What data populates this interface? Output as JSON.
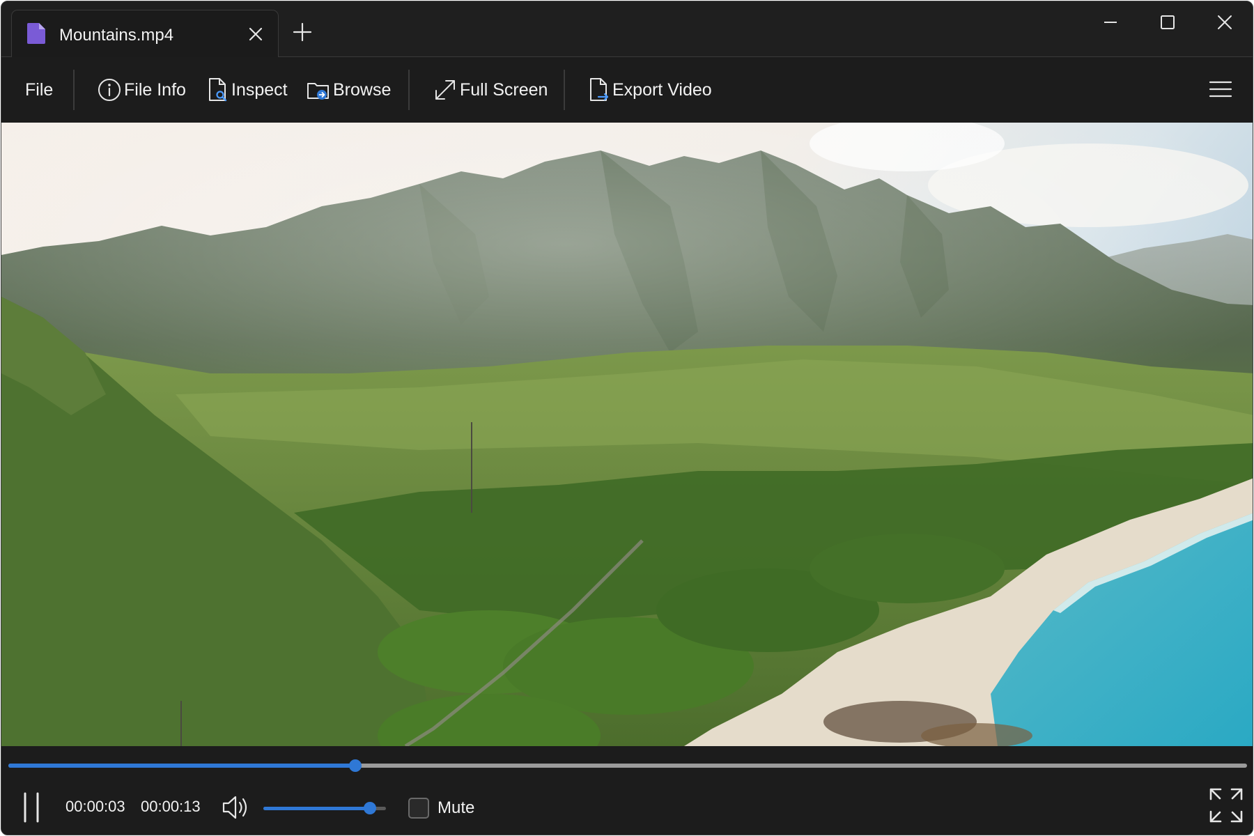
{
  "tab": {
    "title": "Mountains.mp4",
    "icon": "document-icon",
    "accent": "#7a5bd6"
  },
  "toolbar": {
    "file": "File",
    "file_info": "File Info",
    "inspect": "Inspect",
    "browse": "Browse",
    "full_screen": "Full Screen",
    "export_video": "Export Video"
  },
  "video": {
    "scene": "mountain-valley-coastline-frame"
  },
  "playback": {
    "current_time": "00:00:03",
    "total_time": "00:00:13",
    "progress_fraction": 0.28,
    "volume_fraction": 0.87,
    "mute_label": "Mute",
    "muted": false
  },
  "colors": {
    "accent": "#2f78d6",
    "background": "#1f1f1f"
  }
}
